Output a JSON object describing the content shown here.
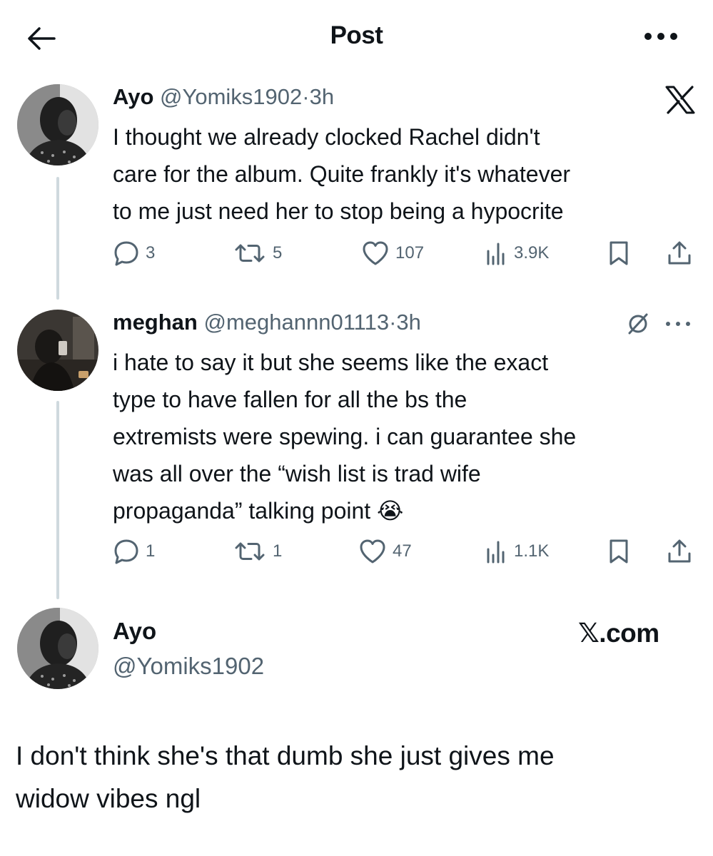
{
  "header": {
    "title": "Post"
  },
  "tweets": [
    {
      "name": "Ayo",
      "handle": "@Yomiks1902",
      "sep": "·",
      "time": "3h",
      "lines": [
        "I thought we already clocked Rachel didn't",
        "care for the album. Quite frankly it's whatever",
        "to me just need her to stop being a hypocrite"
      ],
      "replies": "3",
      "reposts": "5",
      "likes": "107",
      "views": "3.9K"
    },
    {
      "name": "meghan",
      "handle": "@meghannn01113",
      "sep": "·",
      "time": "3h",
      "lines": [
        "i hate to say it but she seems like the exact",
        "type to have fallen for all the bs the",
        "extremists were spewing. i can guarantee she",
        "was all over the “wish list is trad wife",
        "propaganda” talking point 😭"
      ],
      "replies": "1",
      "reposts": "1",
      "likes": "47",
      "views": "1.1K"
    }
  ],
  "quote": {
    "name": "Ayo",
    "handle": "@Yomiks1902",
    "brand": "𝕏.com",
    "lines": [
      "I don't think she's that dumb she just gives me",
      "widow vibes ngl"
    ]
  },
  "icons": {
    "back": "arrow-left-icon",
    "more": "more-horizontal-icon",
    "brand": "x-logo-icon",
    "grok": "slash-circle-icon",
    "reply": "reply-icon",
    "repost": "repost-icon",
    "like": "heart-icon",
    "views": "views-icon",
    "bookmark": "bookmark-icon",
    "share": "share-icon"
  },
  "colors": {
    "text": "#0f1419",
    "secondary": "#536471",
    "thread_line": "#cfd9de"
  }
}
